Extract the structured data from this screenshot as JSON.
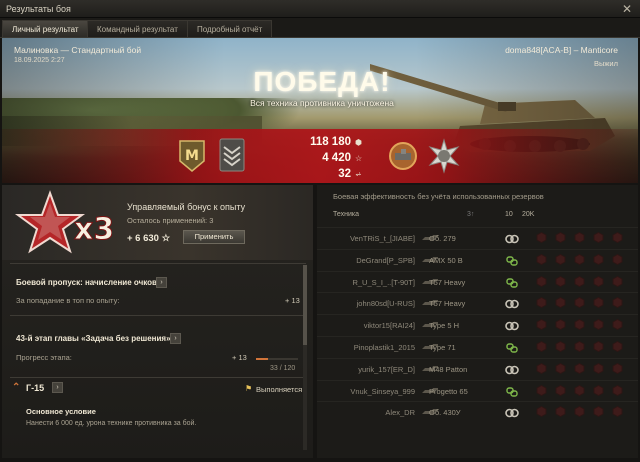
{
  "window": {
    "title": "Результаты боя",
    "close": "✕"
  },
  "tabs": [
    {
      "label": "Личный результат",
      "active": true
    },
    {
      "label": "Командный результат",
      "active": false
    },
    {
      "label": "Подробный отчёт",
      "active": false
    }
  ],
  "banner": {
    "map_mode": "Малиновка — Стандартный бой",
    "datetime": "18.09.2025 2:27",
    "player": "doma848[ACA-B] – Manticore",
    "exit_status": "Выжил",
    "result": "ПОБЕДА!",
    "result_sub": "Вся техника противника уничтожена",
    "rank_letter": "M",
    "stats": [
      {
        "value": "118 180",
        "icon": "credits-icon",
        "glyph": "⬢"
      },
      {
        "value": "4 420",
        "icon": "xp-star-icon",
        "glyph": "☆"
      },
      {
        "value": "32",
        "icon": "free-xp-icon",
        "glyph": "⩫"
      }
    ]
  },
  "bonus": {
    "multiplier": "x3",
    "title": "Управляемый бонус к опыту",
    "remaining": "Осталось применений: 3",
    "amount": "+ 6 630",
    "star": "☆",
    "apply_label": "Применить"
  },
  "battlepass": {
    "title": "Боевой пропуск: начисление очков",
    "arrow": "›",
    "row_label": "За попадание в топ по опыту:",
    "row_value": "+ 13"
  },
  "chapter": {
    "title": "43-й этап главы «Задача без решения»",
    "arrow": "›",
    "progress_label": "Прогресс этапа:",
    "progress_delta": "+ 13",
    "progress_text": "33 / 120",
    "progress_fraction": 0.275
  },
  "mission": {
    "chevron": "⌃",
    "code": "Г-15",
    "arrow": "›",
    "flag": "⚑",
    "status": "Выполняется",
    "condition_title": "Основное условие",
    "condition_text": "Нанести 6 000 ед. урона технике противника за бой."
  },
  "team": {
    "header": "Боевая эффективность без учёта использованных резервов",
    "columns": {
      "vehicle": "Техника",
      "c1": "3↑",
      "c2": "10",
      "c3": "20K"
    },
    "accent_color": "#7fb84a",
    "players": [
      {
        "name": "VenTRiS_t_[JIABE]",
        "tank": "Об. 279",
        "icon": "bond-icon"
      },
      {
        "name": "DeGrand[P_SPB]",
        "tank": "AMX 50 B",
        "icon": "link-icon"
      },
      {
        "name": "R_U_S_I_..[T-90T]",
        "tank": "T57 Heavy",
        "icon": "link-icon"
      },
      {
        "name": "john80sd[U-RUS]",
        "tank": "T57 Heavy",
        "icon": "bond-icon"
      },
      {
        "name": "viktor15[RAI24]",
        "tank": "Type 5 H",
        "icon": "bond-icon"
      },
      {
        "name": "Pinoplastik1_2015",
        "tank": "Type 71",
        "icon": "link-icon"
      },
      {
        "name": "yurik_157[ER_D]",
        "tank": "M48 Patton",
        "icon": "bond-icon"
      },
      {
        "name": "Vnuk_Sinseya_999",
        "tank": "Progetto 65",
        "icon": "link-icon"
      },
      {
        "name": "Alex_DR",
        "tank": "Об. 430У",
        "icon": "bond-icon"
      }
    ]
  }
}
